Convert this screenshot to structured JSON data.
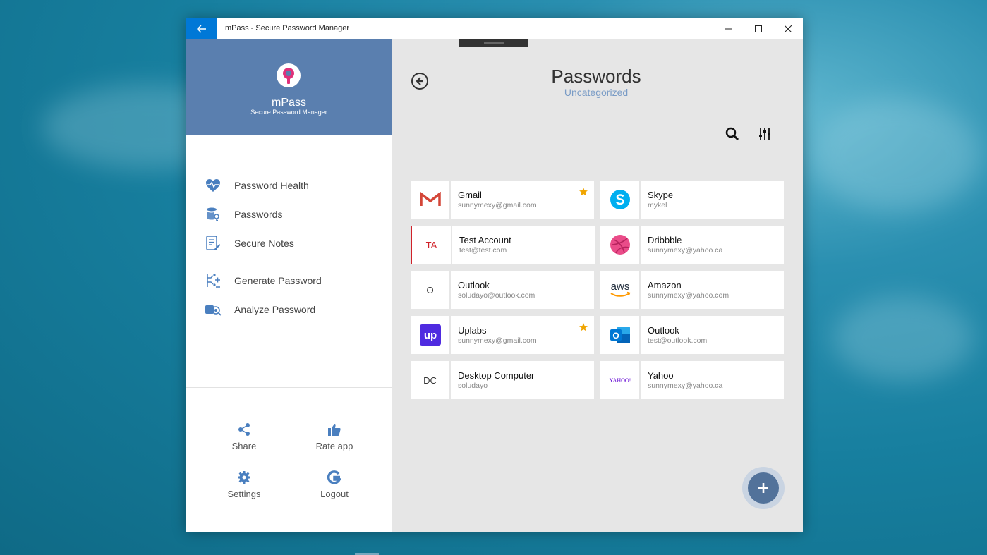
{
  "window": {
    "title": "mPass - Secure Password Manager"
  },
  "brand": {
    "name": "mPass",
    "subtitle": "Secure Password Manager"
  },
  "nav": {
    "items": [
      {
        "label": "Password Health",
        "icon": "heart-pulse-icon"
      },
      {
        "label": "Passwords",
        "icon": "database-key-icon"
      },
      {
        "label": "Secure Notes",
        "icon": "note-edit-icon"
      },
      {
        "label": "Generate Password",
        "icon": "generate-password-icon"
      },
      {
        "label": "Analyze Password",
        "icon": "analyze-password-icon"
      }
    ]
  },
  "footer": {
    "share": "Share",
    "rate": "Rate app",
    "settings": "Settings",
    "logout": "Logout"
  },
  "main": {
    "title": "Passwords",
    "subtitle": "Uncategorized"
  },
  "entries": [
    {
      "name": "Gmail",
      "email": "sunnymexy@gmail.com",
      "icon": "gmail-icon",
      "favorite": true
    },
    {
      "name": "Skype",
      "email": "mykel",
      "icon": "skype-icon",
      "favorite": false
    },
    {
      "name": "Test Account",
      "email": "test@test.com",
      "abbr": "TA",
      "favorite": false
    },
    {
      "name": "Dribbble",
      "email": "sunnymexy@yahoo.ca",
      "icon": "dribbble-icon",
      "favorite": false
    },
    {
      "name": "Outlook",
      "email": "soludayo@outlook.com",
      "abbr": "O",
      "favorite": false
    },
    {
      "name": "Amazon",
      "email": "sunnymexy@yahoo.com",
      "icon": "aws-icon",
      "logo_text": "aws",
      "favorite": false
    },
    {
      "name": "Uplabs",
      "email": "sunnymexy@gmail.com",
      "icon": "uplabs-icon",
      "logo_text": "up",
      "favorite": true
    },
    {
      "name": "Outlook",
      "email": "test@outlook.com",
      "icon": "outlook-icon",
      "logo_text": "O",
      "favorite": false
    },
    {
      "name": "Desktop Computer",
      "email": "soludayo",
      "abbr": "DC",
      "favorite": false
    },
    {
      "name": "Yahoo",
      "email": "sunnymexy@yahoo.ca",
      "icon": "yahoo-icon",
      "logo_text": "YAHOO!",
      "favorite": false
    }
  ],
  "colors": {
    "accent": "#0078d7",
    "brand_header": "#5a7faf",
    "nav_icon": "#4a7fbf",
    "subtitle": "#7a9cc6",
    "fab": "#52729a",
    "star": "#f0a500",
    "flag": "#d0222a"
  }
}
